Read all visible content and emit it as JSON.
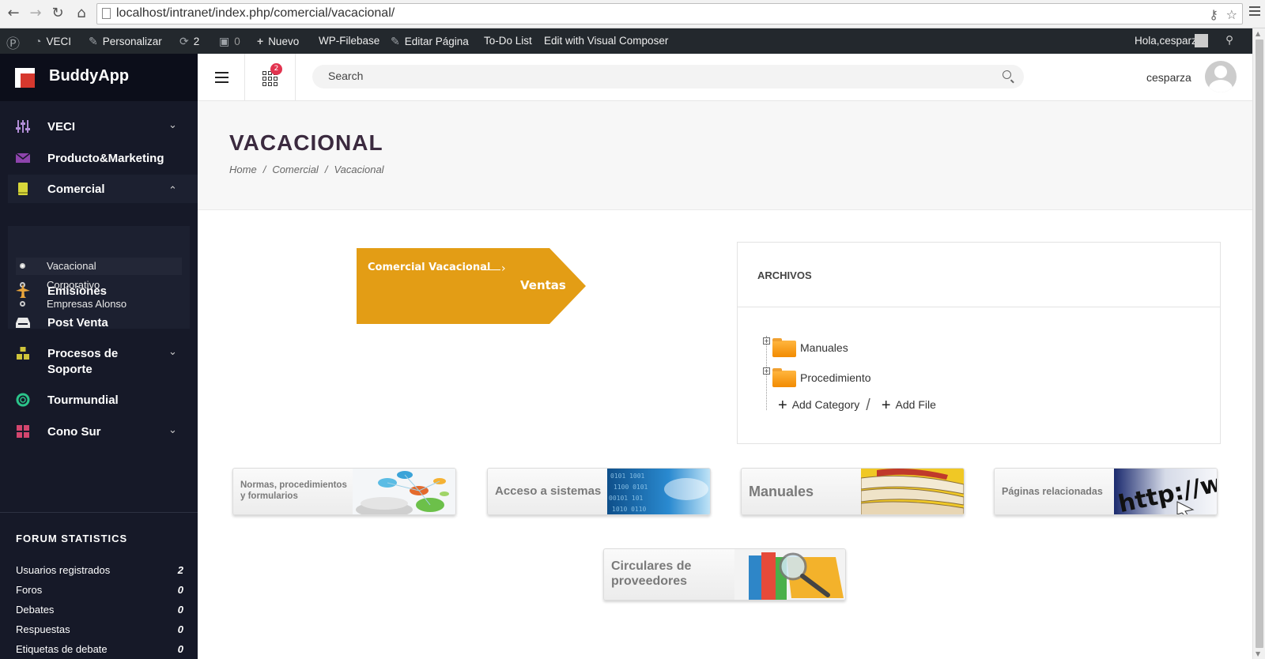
{
  "browser": {
    "url": "localhost/intranet/index.php/comercial/vacacional/"
  },
  "adminbar": {
    "site": "VECI",
    "customize": "Personalizar",
    "updates": "2",
    "comments": "0",
    "new": "Nuevo",
    "filebase": "WP-Filebase",
    "edit_page": "Editar Página",
    "todo": "To-Do List",
    "visual_composer": "Edit with Visual Composer",
    "greeting": "Hola,cesparza"
  },
  "sidebar": {
    "brand": "BuddyApp",
    "menu": [
      {
        "label": "VECI",
        "icon": "sliders-icon"
      },
      {
        "label": "Producto&Marketing",
        "icon": "envelope-icon"
      },
      {
        "label": "Comercial",
        "icon": "book-icon"
      },
      {
        "label": "Emisiones",
        "icon": "plane-icon"
      },
      {
        "label": "Post Venta",
        "icon": "inbox-icon"
      },
      {
        "label": "Procesos de Soporte",
        "icon": "cubes-icon"
      },
      {
        "label": "Tourmundial",
        "icon": "lifebuoy-icon"
      },
      {
        "label": "Cono Sur",
        "icon": "grid-icon"
      }
    ],
    "submenu": [
      "Vacacional",
      "Corporativo",
      "Empresas Alonso"
    ],
    "forum_title": "FORUM STATISTICS",
    "stats": [
      {
        "label": "Usuarios registrados",
        "value": "2"
      },
      {
        "label": "Foros",
        "value": "0"
      },
      {
        "label": "Debates",
        "value": "0"
      },
      {
        "label": "Respuestas",
        "value": "0"
      },
      {
        "label": "Etiquetas de debate",
        "value": "0"
      }
    ],
    "colors": {
      "background": "#161928",
      "brand_bg": "#0c0e1a"
    }
  },
  "header": {
    "notification_count": "2",
    "search_placeholder": "Search",
    "username": "cesparza"
  },
  "page": {
    "title": "VACACIONAL",
    "breadcrumb": [
      "Home",
      "Comercial",
      "Vacacional"
    ]
  },
  "flow": {
    "from": "Comercial Vacacional",
    "to": "Ventas",
    "color": "#e39d15"
  },
  "archivos": {
    "title": "ARCHIVOS",
    "folders": [
      "Manuales",
      "Procedimiento"
    ],
    "add_category": "Add Category",
    "add_file": "Add File"
  },
  "tiles": [
    {
      "line1": "Normas, procedimientos",
      "line2": "y formularios"
    },
    {
      "line1": "Acceso a sistemas"
    },
    {
      "line1": "Manuales"
    },
    {
      "line1": "Páginas relacionadas"
    },
    {
      "line1": "Circulares de",
      "line2": "proveedores"
    }
  ]
}
